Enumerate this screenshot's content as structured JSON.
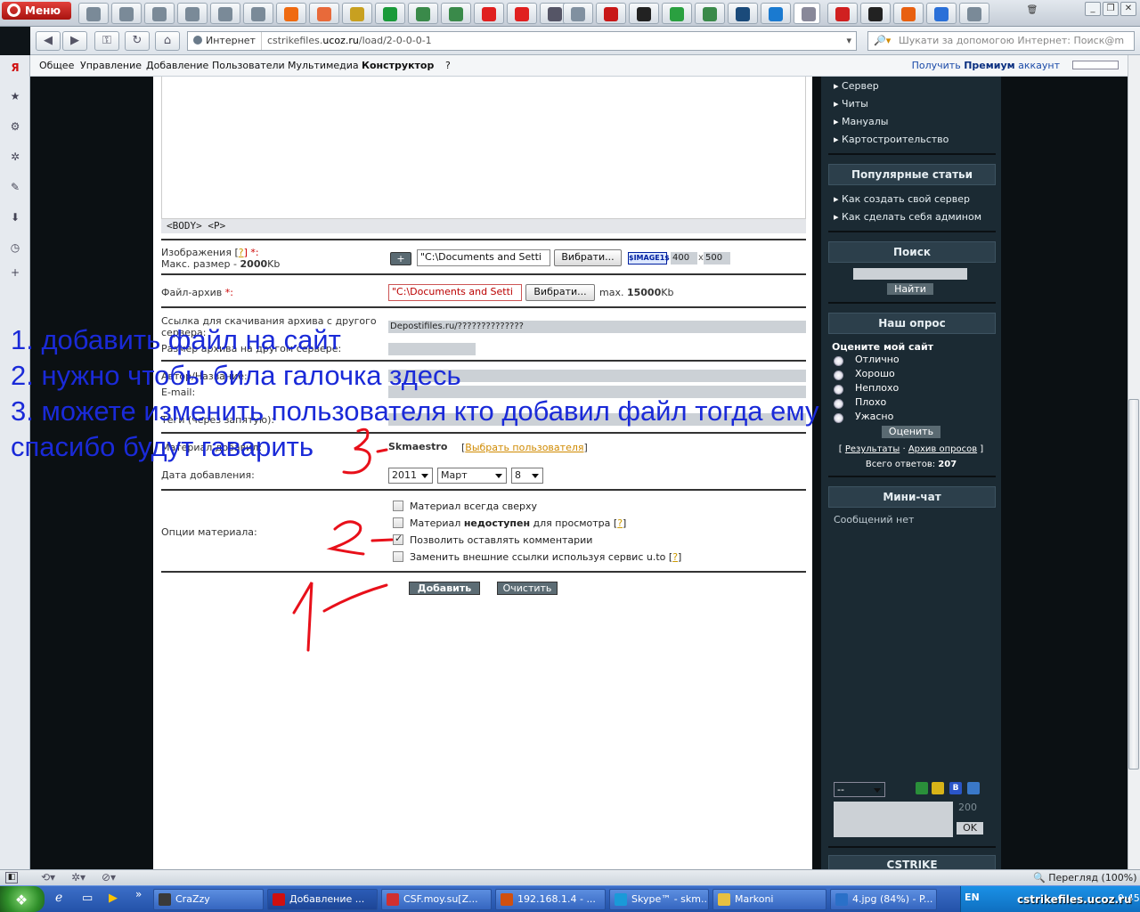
{
  "browser": {
    "menu_label": "Меню",
    "address_zone": "Интернет",
    "url_host": "cstrikefiles.",
    "url_domain": "ucoz.ru",
    "url_path": "/load/2-0-0-0-1",
    "search_placeholder": "Шукати за допомогою Интернет: Поиск@m",
    "status_zoom": "Перегляд (100%)",
    "tab_icons": [
      "opera-icon",
      "opera-icon",
      "opera-icon",
      "opera-icon",
      "opera-icon",
      "opera-icon",
      "f-icon",
      "s-icon",
      "download-icon",
      "green-icon",
      "doc-icon",
      "doc-icon",
      "yandex-icon",
      "yandex-icon",
      "nav-left-icon",
      "p-icon",
      "red-icon",
      "iseo-icon",
      "green-swirl-icon",
      "doc-icon",
      "eye-icon",
      "c-icon",
      "active-tab-icon",
      "opera-red-icon",
      "inverted-icon",
      "orange-icon",
      "blue-icon",
      "plus-icon"
    ]
  },
  "ucoz_bar": {
    "items": [
      "Общее",
      "Управление",
      "Добавление",
      "Пользователи",
      "Мультимедиа",
      "Конструктор",
      "?"
    ],
    "premium_prefix": "Получить",
    "premium_bold": "Премиум",
    "premium_suffix": "аккаунт"
  },
  "editor": {
    "path": "<BODY> <P>"
  },
  "form": {
    "images_label": "Изображения [",
    "images_help": "?",
    "images_req": "] *:",
    "images_max": "Макс. размер -",
    "images_max_val": "2000",
    "images_max_unit": "Kb",
    "image_value": "\"C:\\Documents and Setti",
    "browse": "Вибрати...",
    "image_tag": "$IMAGE1$",
    "image_w": "400",
    "image_x": "x",
    "image_h": "500",
    "add_icon": "+",
    "archive_label": "Файл-архив",
    "archive_req": " *:",
    "archive_value": "\"C:\\Documents and Setti",
    "archive_max_prefix": "max.",
    "archive_max": "15000",
    "archive_max_unit": "Kb",
    "link_label": "Ссылка для скачивания архива с другого сервера:",
    "link_value": "Depostifiles.ru/??????????????",
    "size_label": "Размер архива на другом сервере:",
    "author_label": "Автор/Название:",
    "email_label": "E-mail:",
    "tags_label": "Теги (через запятую):",
    "added_by_label": "Материал добавил:",
    "added_by": "Skmaestro",
    "choose_user": "Выбрать пользователя",
    "date_label": "Дата добавления:",
    "year": "2011",
    "month": "Март",
    "day": "8",
    "options_label": "Опции материала:",
    "opt1": "Материал всегда сверху",
    "opt2_a": "Материал ",
    "opt2_b": "недоступен",
    "opt2_c": " для просмотра [",
    "opt2_help": "?",
    "opt2_end": "]",
    "opt3": "Позволить оставлять комментарии",
    "opt3_checked": true,
    "opt4": "Заменить внешние ссылки используя сервис u.to [",
    "opt4_help": "?",
    "opt4_end": "]",
    "submit": "Добавить",
    "reset": "Очистить"
  },
  "sidebar": {
    "links_top": [
      "Сервер",
      "Читы",
      "Мануалы",
      "Картостроительство"
    ],
    "popular_title": "Популярные статьи",
    "popular": [
      "Как создать свой сервер",
      "Как сделать себя админом"
    ],
    "search_title": "Поиск",
    "search_btn": "Найти",
    "poll_title": "Наш опрос",
    "poll_question": "Оцените мой сайт",
    "poll_options": [
      "Отлично",
      "Хорошо",
      "Неплохо",
      "Плохо",
      "Ужасно"
    ],
    "poll_btn": "Оценить",
    "poll_results": "Результаты",
    "poll_archive": "Архив опросов",
    "poll_total_label": "Всего ответов:",
    "poll_total": "207",
    "chat_title": "Мини-чат",
    "chat_empty": "Сообщений нет",
    "chat_select": "--",
    "chat_count": "200",
    "chat_ok": "OK",
    "cstrike_title": "CSTRIKE"
  },
  "annotations": {
    "line1": "1. добавить файл на сайт",
    "line2": "2. нужно чтобы била галочка здесь",
    "line3": "3. можете изменить пользователя кто добавил файл тогда ему",
    "line4": "спасибо будут гаварить",
    "color": "#1a2ad8",
    "marker_color": "#e8101a"
  },
  "taskbar": {
    "items": [
      "CraZzy",
      "Добавление ...",
      "CSF.moy.su[Z...",
      "192.168.1.4 - ...",
      "Skype™ - skm...",
      "Markoni",
      "4.jpg (84%) - P..."
    ],
    "lang": "EN",
    "clock": "0:45",
    "watermark": "cstrikefiles.ucoz.ru"
  }
}
